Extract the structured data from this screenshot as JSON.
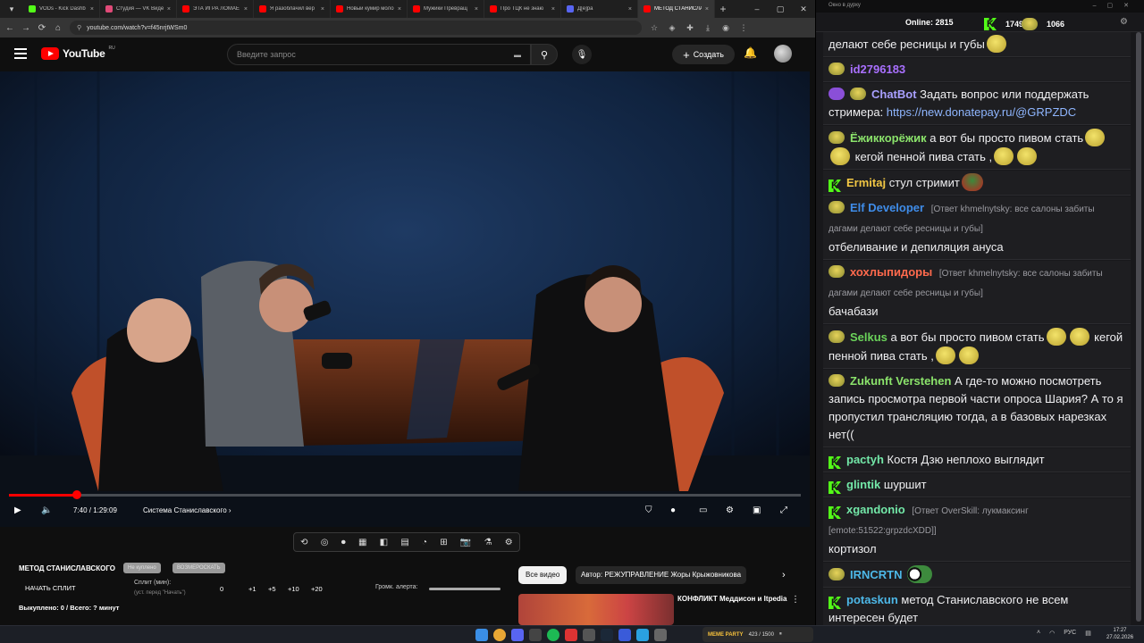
{
  "tabs": [
    {
      "title": "VODs - Kick Dashb",
      "favicon_color": "#53fc18",
      "active": false
    },
    {
      "title": "Студия — VK Видео",
      "favicon_color": "#e04a78",
      "active": false
    },
    {
      "title": "ЭТА ИГРА ЛОМАЕ",
      "favicon_color": "#ff0000",
      "active": false
    },
    {
      "title": "Я разоблачил вер",
      "favicon_color": "#ff0000",
      "active": false
    },
    {
      "title": "Новый кумир моло",
      "favicon_color": "#ff0000",
      "active": false
    },
    {
      "title": "Мужики Превращ",
      "favicon_color": "#ff0000",
      "active": false
    },
    {
      "title": "Про ТЦК не знаю",
      "favicon_color": "#ff0000",
      "active": false
    },
    {
      "title": "Д[е]ра",
      "favicon_color": "#5865f2",
      "active": false
    },
    {
      "title": "МЕТОД СТАНИСЛА",
      "favicon_color": "#ff0000",
      "active": true
    }
  ],
  "address": {
    "url": "youtube.com/watch?v=f45nrjtWSm0"
  },
  "youtube": {
    "region": "RU",
    "logo_text": "YouTube",
    "search_placeholder": "Введите запрос",
    "create_label": "Создать"
  },
  "player": {
    "time": "7:40 / 1:29:09",
    "chapter": "Система Станиславского",
    "progress_fraction": 0.086
  },
  "ext": {
    "title": "МЕТОД СТАНИСЛАВСКОГО",
    "pill1": "Не куплено",
    "pill2": "ВОЗМЕРОСКАТЬ",
    "split_label": "НАЧАТЬ СПЛИТ",
    "split_minutes": "Сплит (мин):",
    "split_hint": "(уст. перед \"Начать\")",
    "split_value": "0",
    "inc": [
      "+1",
      "+5",
      "+10",
      "+20"
    ],
    "alert_label": "Громк. алерта:",
    "bought": "Выкуплено: 0 / Всего: ? минут"
  },
  "recs": {
    "all_label": "Все видео",
    "author_label": "Автор: РЕЖУПРАВЛЕНИЕ Жоры Крыжовникова",
    "item_title": "КОНФЛИКТ Меддисон и Itpedia"
  },
  "chat": {
    "window_title": "Окно в дурку",
    "online_label": "Online:",
    "online": "2815",
    "k_count": "1749",
    "e_count": "1066",
    "messages": [
      {
        "user": "",
        "color": "#fff",
        "text": "делают себе ресницы и губы",
        "reply": "",
        "badge": "",
        "emotes_after": 1
      },
      {
        "user": "id2796183",
        "color": "#a970ff",
        "text": "",
        "reply": "",
        "badge": "yellow",
        "emotes_after": 0
      },
      {
        "user": "ChatBot",
        "color": "#a9a0ff",
        "text": "Задать вопрос или поддержать стримера: ",
        "link": "https://new.donatepay.ru/@GRPZDC",
        "reply": "",
        "badge": "bot",
        "emotes_after": 0
      },
      {
        "user": "Ёжиккорёжик",
        "color": "#8be36b",
        "text": "а вот бы просто пивом стать",
        "text2": "кегой пенной пива стать ,",
        "reply": "",
        "badge": "yellow",
        "emotes_after": 2
      },
      {
        "user": "Ermitaj",
        "color": "#f2c744",
        "text": "стул стримит",
        "reply": "",
        "badge": "kick",
        "emotes_after": 1,
        "frog": true
      },
      {
        "user": "Elf Developer",
        "color": "#3f8ce8",
        "text": "отбеливание и депиляция ануса",
        "reply": "[Ответ khmelnytsky: все салоны забиты дагами делают себе ресницы и губы]",
        "badge": "yellow",
        "emotes_after": 0
      },
      {
        "user": "хохлыпидоры",
        "color": "#ff6a4d",
        "text": "бачабази",
        "reply": "[Ответ khmelnytsky: все салоны забиты дагами делают себе ресницы и губы]",
        "badge": "yellow",
        "emotes_after": 0
      },
      {
        "user": "Selkus",
        "color": "#6bd35a",
        "text": "а вот бы просто пивом стать",
        "text2": "кегой пенной пива стать ,",
        "reply": "",
        "badge": "yellow",
        "emotes_after": 2
      },
      {
        "user": "Zukunft Verstehen",
        "color": "#8be36b",
        "text": "А где-то можно посмотреть запись просмотра первой части опроса Шария? А то я пропустил трансляцию тогда, а в базовых нарезках нет((",
        "reply": "",
        "badge": "yellow",
        "emotes_after": 0
      },
      {
        "user": "pactyh",
        "color": "#73e8a8",
        "text": "Костя Дзю неплохо выглядит",
        "reply": "",
        "badge": "kick",
        "emotes_after": 0
      },
      {
        "user": "glintik",
        "color": "#73e8a8",
        "text": "шуршит",
        "reply": "",
        "badge": "kick",
        "emotes_after": 0
      },
      {
        "user": "xgandonio",
        "color": "#73e8a8",
        "text": "кортизол",
        "reply": "[Ответ OverSkill: лукмаксинг [emote:51522:grpzdcXDD]]",
        "badge": "kick",
        "emotes_after": 0
      },
      {
        "user": "IRNCRTN",
        "color": "#4db8e8",
        "text": "",
        "reply": "",
        "badge": "yellow",
        "emotes_after": 0,
        "eyes": true
      },
      {
        "user": "potaskun",
        "color": "#4db8e8",
        "text": "метод Станиславского не всем интересен будет",
        "reply": "",
        "badge": "kick",
        "emotes_after": 0
      }
    ]
  },
  "taskbar": {
    "media_label": "MEME PARTY",
    "media_time": "423 / 1500",
    "lang": "РУС",
    "time": "17:27",
    "date": "27.02.2026"
  }
}
